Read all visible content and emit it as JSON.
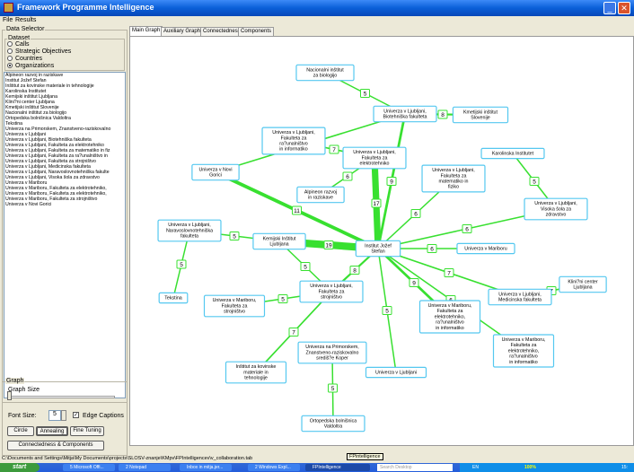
{
  "window": {
    "title": "Framework Programme Intelligence",
    "min_label": "_",
    "close_label": "✕"
  },
  "menu": [
    "File",
    "Results"
  ],
  "data_selector": {
    "title": "Data Selector",
    "dataset_label": "Dataset",
    "options": [
      "Calls",
      "Strategic Objectives",
      "Countries",
      "Organizations"
    ],
    "selected": "Organizations"
  },
  "organizations": [
    "Alpineon razvoj in raziskave",
    "Institut Jožef Stefan",
    "Inštitut za kovinske materiale in tehnologije",
    "Karolinska Institutet",
    "Kemijski inštitut Ljubljana",
    "Klini?ni center Ljubljana",
    "Kmetijski inštitut Slovenije",
    "Nacionalni inštitut za biologijo",
    "Ortopedska bolnišnica Valdoltra",
    "Tekstina",
    "Univerza na Primorskem, Znanstveno-raziskovalno",
    "Univerza v Ljubljani",
    "Univerza v Ljubljani, Biotehniška fakulteta",
    "Univerza v Ljubljani, Fakulteta za elektrotehniko",
    "Univerza v Ljubljani, Fakulteta za matematiko in fiz",
    "Univerza v Ljubljani, Fakulteta za ra?unalništvo in",
    "Univerza v Ljubljani, Fakulteta za strojništvo",
    "Univerza v Ljubljani, Medicinska fakulteta",
    "Univerza v Ljubljani, Naravoslovnotehniška fakulte",
    "Univerza v Ljubljani, Visoka šola za zdravstvo",
    "Univerza v Mariboru",
    "Univerza v Mariboru, Fakulteta za elektrotehniko,",
    "Univerza v Mariboru, Fakulteta za elektrotehniko,",
    "Univerza v Mariboru, Fakulteta za strojništvo",
    "Univerza v Novi Gorici"
  ],
  "graph_panel": {
    "title": "Graph",
    "size_label": "Graph Size",
    "font_size_label": "Font Size:",
    "font_size_value": "5",
    "edge_captions_label": "Edge Captions",
    "edge_captions_checked": true,
    "buttons": [
      "Circle",
      "Annealing",
      "Fine Tuning"
    ],
    "connectedness_button": "Connectedness & Components"
  },
  "tabs": [
    "Main Graph",
    "Auxiliary Graph",
    "Connectedness",
    "Components"
  ],
  "active_tab": "Main Graph",
  "graph": {
    "edge_color": "#38e030",
    "node_border_color": "#55c8f0",
    "nodes": [
      {
        "id": "nib",
        "label": [
          "Nacionalni inštitut",
          "za biologijo"
        ]
      },
      {
        "id": "kis",
        "label": [
          "Kmetijski inštitut",
          "Slovenije"
        ]
      },
      {
        "id": "bf",
        "label": [
          "Univerza v Ljubljani,",
          "Biotehniška fakulteta"
        ]
      },
      {
        "id": "fri",
        "label": [
          "Univerza v Ljubljani,",
          "Fakulteta za",
          "ra?unalništvo",
          "in informatiko"
        ]
      },
      {
        "id": "ung",
        "label": [
          "Univerza v Novi",
          "Gorici"
        ]
      },
      {
        "id": "fe",
        "label": [
          "Univerza v Ljubljani,",
          "Fakulteta za",
          "elektrotehniko"
        ]
      },
      {
        "id": "alp",
        "label": [
          "Alpineon razvoj",
          "in raziskave"
        ]
      },
      {
        "id": "ki",
        "label": [
          "Karolinska Institutet"
        ]
      },
      {
        "id": "fmf",
        "label": [
          "Univerza v Ljubljani,",
          "Fakulteta za",
          "matematiko in",
          "fiziko"
        ]
      },
      {
        "id": "vsz",
        "label": [
          "Univerza v Ljubljani,",
          "Visoka šola za",
          "zdravstvo"
        ]
      },
      {
        "id": "ntf",
        "label": [
          "Univerza v Ljubljani,",
          "Naravoslovnotehniška",
          "fakulteta"
        ]
      },
      {
        "id": "kem",
        "label": [
          "Kemijski Inštitut",
          "Ljubljana"
        ]
      },
      {
        "id": "ijs",
        "label": [
          "Institut Jožef",
          "Stefan"
        ]
      },
      {
        "id": "um",
        "label": [
          "Univerza v Mariboru"
        ]
      },
      {
        "id": "tek",
        "label": [
          "Tekstina"
        ]
      },
      {
        "id": "fs",
        "label": [
          "Univerza v Ljubljani,",
          "Fakulteta za",
          "strojništvo"
        ]
      },
      {
        "id": "kcl",
        "label": [
          "Klini?ni center",
          "Ljubljana"
        ]
      },
      {
        "id": "ums",
        "label": [
          "Univerza v Mariboru,",
          "Fakulteta za",
          "strojništvo"
        ]
      },
      {
        "id": "mf",
        "label": [
          "Univerza v Ljubljani,",
          "Medicinska fakulteta"
        ]
      },
      {
        "id": "umfe1",
        "label": [
          "Univerza v Mariboru,",
          "Fakulteta za",
          "elektrotehniko,",
          "ra?unalništvo",
          "in informatiko"
        ]
      },
      {
        "id": "umfe2",
        "label": [
          "Univerza v Mariboru,",
          "Fakulteta za",
          "elektrotehniko,",
          "ra?unalništvo",
          "in informatiko"
        ]
      },
      {
        "id": "upr",
        "label": [
          "Univerza na Primorskem,",
          "Znanstveno-raziskovalno",
          "središ?e Koper"
        ]
      },
      {
        "id": "imt",
        "label": [
          "Inštitut za kovinske",
          "materiale in",
          "tehnologije"
        ]
      },
      {
        "id": "ul",
        "label": [
          "Univerza v Ljubljani"
        ]
      },
      {
        "id": "obv",
        "label": [
          "Ortopedska bolnišnica",
          "Valdoltra"
        ]
      }
    ],
    "edges": [
      {
        "from": "nib",
        "to": "bf",
        "weight": 5
      },
      {
        "from": "kis",
        "to": "bf",
        "weight": 8
      },
      {
        "from": "bf",
        "to": "ung",
        "weight": 7
      },
      {
        "from": "bf",
        "to": "ijs",
        "weight": 9
      },
      {
        "from": "fri",
        "to": "fe",
        "weight": 7
      },
      {
        "from": "fe",
        "to": "alp",
        "weight": 6
      },
      {
        "from": "fe",
        "to": "ijs",
        "weight": 17
      },
      {
        "from": "ung",
        "to": "ijs",
        "weight": 11
      },
      {
        "from": "fmf",
        "to": "ijs",
        "weight": 6
      },
      {
        "from": "ki",
        "to": "vsz",
        "weight": 5
      },
      {
        "from": "vsz",
        "to": "ijs",
        "weight": 6
      },
      {
        "from": "ntf",
        "to": "kem",
        "weight": 5
      },
      {
        "from": "ntf",
        "to": "tek",
        "weight": 5
      },
      {
        "from": "kem",
        "to": "ijs",
        "weight": 19
      },
      {
        "from": "kem",
        "to": "fs",
        "weight": 5
      },
      {
        "from": "um",
        "to": "ijs",
        "weight": 6
      },
      {
        "from": "fs",
        "to": "ijs",
        "weight": 8
      },
      {
        "from": "fs",
        "to": "ums",
        "weight": 5
      },
      {
        "from": "fs",
        "to": "imt",
        "weight": 7
      },
      {
        "from": "mf",
        "to": "ijs",
        "weight": 7
      },
      {
        "from": "kcl",
        "to": "mf",
        "weight": 7
      },
      {
        "from": "umfe1",
        "to": "ijs",
        "weight": 9
      },
      {
        "from": "umfe2",
        "to": "ijs",
        "weight": 6
      },
      {
        "from": "ul",
        "to": "ijs",
        "weight": 5
      },
      {
        "from": "upr",
        "to": "obv",
        "weight": 5
      }
    ]
  },
  "statusbar": {
    "path": "C:\\Documents and Settings\\Mitja\\My Documents\\projects\\SLOSV-znanje\\KMpv\\FPIntelligencev\\v_collaboration.tab",
    "tooltip": "FPintelligence"
  },
  "taskbar": {
    "start": "start",
    "tasks": [
      "5 Microsoft Offi...",
      "2 Notepad",
      "Inbox in mitja.jer...",
      "2 Windows Expl...",
      "FPIntelligence"
    ],
    "search_placeholder": "Search Desktop",
    "tray_lang": "EN",
    "tray_zoom": "100%",
    "clock": "15:"
  }
}
